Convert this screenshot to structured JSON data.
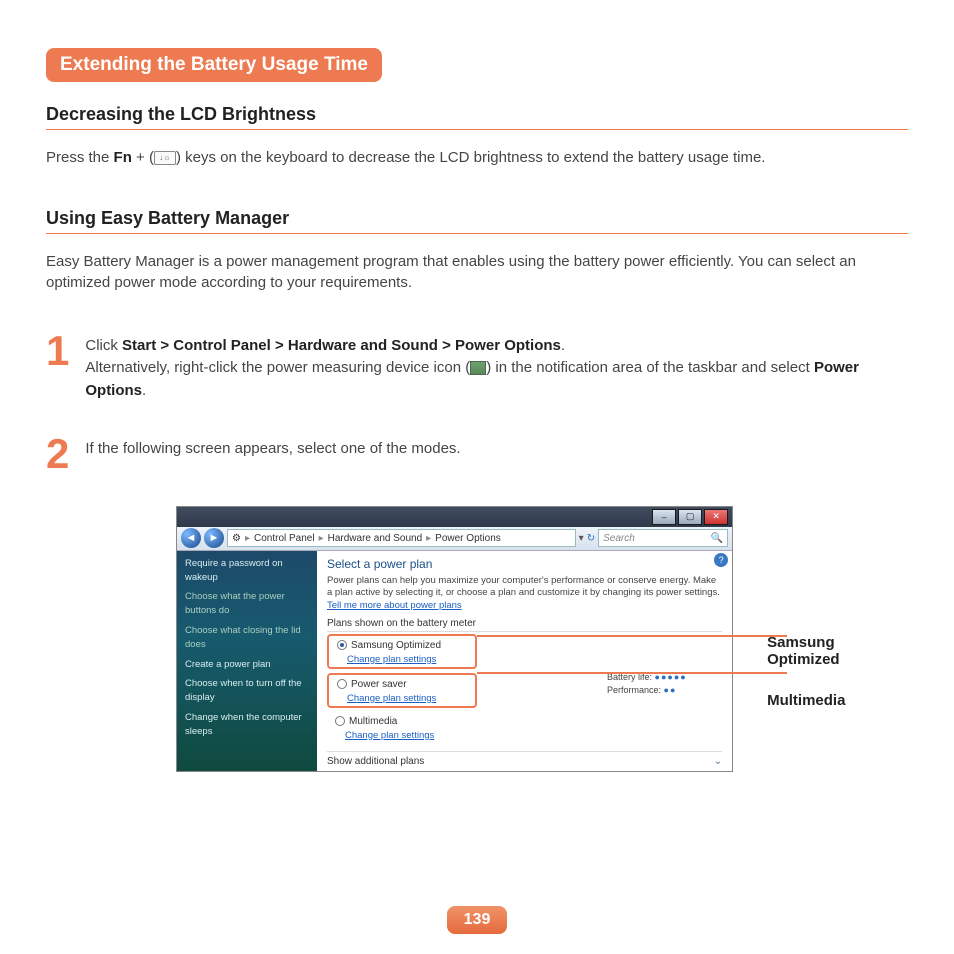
{
  "badge": "Extending the Battery Usage Time",
  "sections": {
    "lcd": {
      "title": "Decreasing the LCD Brightness",
      "text_pre": "Press the ",
      "fn": "Fn",
      "text_mid": " + (",
      "key_glyph": "↓☼",
      "text_post": ") keys on the keyboard to decrease the LCD brightness to extend the battery usage time."
    },
    "ebm": {
      "title": "Using Easy Battery Manager",
      "intro": "Easy Battery Manager is a power management program that enables using the battery power efficiently. You can select an optimized power mode according to your requirements."
    }
  },
  "steps": [
    {
      "num": "1",
      "line1_pre": "Click ",
      "line1_bold": "Start > Control Panel > Hardware and Sound > Power Options",
      "line1_post": ".",
      "line2_pre": "Alternatively, right-click the power measuring device icon (",
      "line2_post": ") in the notification area of the taskbar and select ",
      "line2_bold": "Power Options",
      "line2_end": "."
    },
    {
      "num": "2",
      "text": "If the following screen appears, select one of the modes."
    }
  ],
  "window": {
    "breadcrumb": [
      "Control Panel",
      "Hardware and Sound",
      "Power Options"
    ],
    "search_placeholder": "Search",
    "sidebar": [
      "Require a password on wakeup",
      "Choose what the power buttons do",
      "Choose what closing the lid does",
      "Create a power plan",
      "Choose when to turn off the display",
      "Change when the computer sleeps"
    ],
    "content": {
      "title": "Select a power plan",
      "desc": "Power plans can help you maximize your computer's performance or conserve energy. Make a plan active by selecting it, or choose a plan and customize it by changing its power settings. ",
      "link1": "Tell me more about power plans",
      "sub": "Plans shown on the battery meter",
      "plans": [
        {
          "name": "Samsung Optimized",
          "link": "Change plan settings",
          "selected": true,
          "highlight": true
        },
        {
          "name": "Power saver",
          "link": "Change plan settings",
          "selected": false,
          "highlight": true
        },
        {
          "name": "Multimedia",
          "link": "Change plan settings",
          "selected": false,
          "highlight": false
        }
      ],
      "battery_life": "Battery life:",
      "performance": "Performance:",
      "show": "Show additional plans"
    }
  },
  "callouts": [
    "Samsung Optimized",
    "Multimedia"
  ],
  "page_number": "139"
}
